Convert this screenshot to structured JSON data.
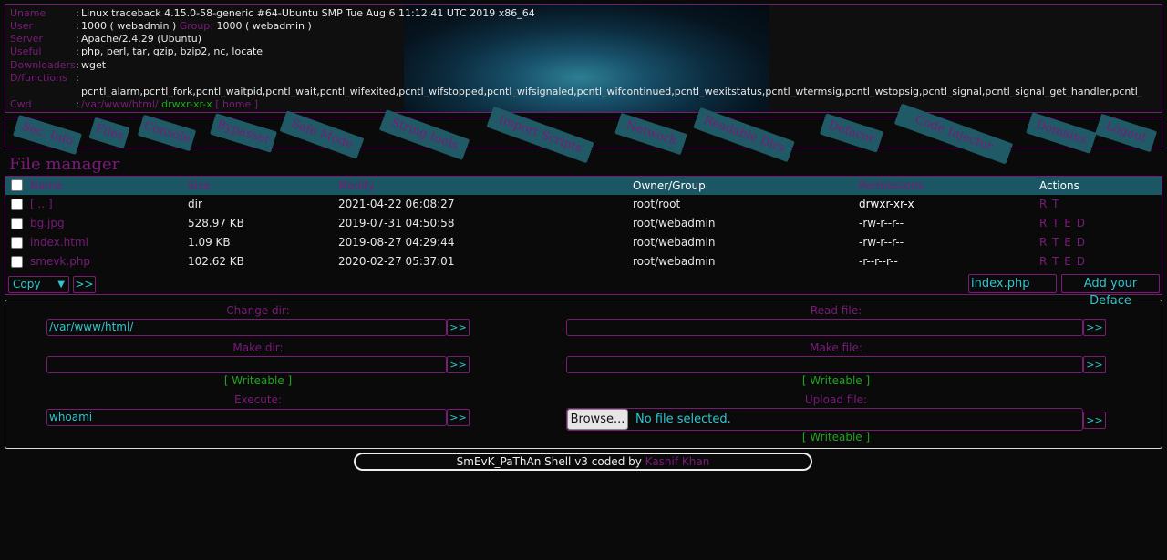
{
  "sysinfo": {
    "uname_label": "Uname",
    "uname": "Linux traceback 4.15.0-58-generic #64-Ubuntu SMP Tue Aug 6 11:12:41 UTC 2019 x86_64",
    "user_label": "User",
    "user": "1000 ( webadmin )",
    "group_label": "Group:",
    "group": "1000 ( webadmin )",
    "server_label": "Server",
    "server": "Apache/2.4.29 (Ubuntu)",
    "useful_label": "Useful",
    "useful": "php, perl, tar, gzip, bzip2, nc, locate",
    "downloaders_label": "Downloaders",
    "downloaders": "wget",
    "dfunctions_label": "D/functions",
    "dfunctions": "pcntl_alarm,pcntl_fork,pcntl_waitpid,pcntl_wait,pcntl_wifexited,pcntl_wifstopped,pcntl_wifsignaled,pcntl_wifcontinued,pcntl_wexitstatus,pcntl_wtermsig,pcntl_wstopsig,pcntl_signal,pcntl_signal_get_handler,pcntl_",
    "cwd_label": "Cwd",
    "cwd_path": "/var/www/html/",
    "cwd_perm": "drwxr-xr-x",
    "cwd_home": "[ home ]",
    "colon": ":"
  },
  "nav": [
    "Sec. Info",
    "Files",
    "Console",
    "Bypasser",
    "Safe Mode",
    "String tools",
    "Import Scripts",
    "Network",
    "Readable Dirs",
    "Defacer",
    "Code Injector",
    "Domains",
    "Logout"
  ],
  "file_manager": {
    "title": "File manager",
    "headers": {
      "name": "Name",
      "size": "Size",
      "modify": "Modify",
      "owner": "Owner/Group",
      "permissions": "Permissions",
      "actions": "Actions"
    },
    "rows": [
      {
        "name": "[ .. ]",
        "size": "dir",
        "modify": "2021-04-22 06:08:27",
        "owner": "root/root",
        "perms": "drwxr-xr-x",
        "actions": "R T"
      },
      {
        "name": "bg.jpg",
        "size": "528.97 KB",
        "modify": "2019-07-31 04:50:58",
        "owner": "root/webadmin",
        "perms": "-rw-r--r--",
        "actions": "R T E D"
      },
      {
        "name": "index.html",
        "size": "1.09 KB",
        "modify": "2019-08-27 04:29:44",
        "owner": "root/webadmin",
        "perms": "-rw-r--r--",
        "actions": "R T E D"
      },
      {
        "name": "smevk.php",
        "size": "102.62 KB",
        "modify": "2020-02-27 05:37:01",
        "owner": "root/webadmin",
        "perms": "-r--r--r--",
        "actions": "R T E D"
      }
    ],
    "action_select": "Copy",
    "go_label": ">>",
    "deface_filename": "index.php",
    "deface_button": "Add your Deface"
  },
  "tools": {
    "change_dir_label": "Change dir:",
    "change_dir_value": "/var/www/html/",
    "read_file_label": "Read file:",
    "read_file_value": "",
    "make_dir_label": "Make dir:",
    "make_dir_value": "",
    "make_file_label": "Make file:",
    "make_file_value": "",
    "writeable": "[ Writeable ]",
    "execute_label": "Execute:",
    "execute_value": "whoami",
    "upload_label": "Upload file:",
    "browse_label": "Browse...",
    "no_file": "No file selected.",
    "go_label": ">>"
  },
  "footer": {
    "text": "SmEvK_PaThAn Shell v3 coded by",
    "author": "Kashif Khan"
  },
  "colors": {
    "accent": "#7a1b7a",
    "cyan": "#2ec6d0",
    "green": "#1fa61f",
    "teal_header": "#1a5664"
  }
}
